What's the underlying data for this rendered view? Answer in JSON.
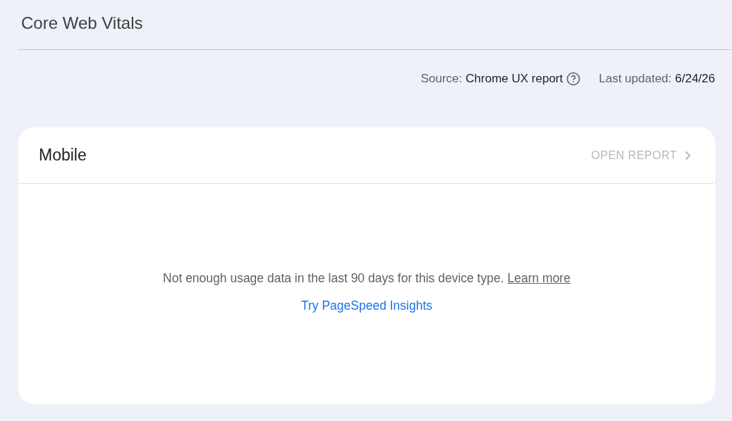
{
  "page_title": "Core Web Vitals",
  "meta": {
    "source_label": "Source:",
    "source_value": "Chrome UX report",
    "updated_label": "Last updated:",
    "updated_value": "6/24/26"
  },
  "card": {
    "title": "Mobile",
    "action": {
      "label": "OPEN REPORT",
      "disabled": true
    },
    "message": "Not enough usage data in the last 90 days for this device type.",
    "message_link": "Learn more",
    "secondary_link": "Try PageSpeed Insights"
  }
}
